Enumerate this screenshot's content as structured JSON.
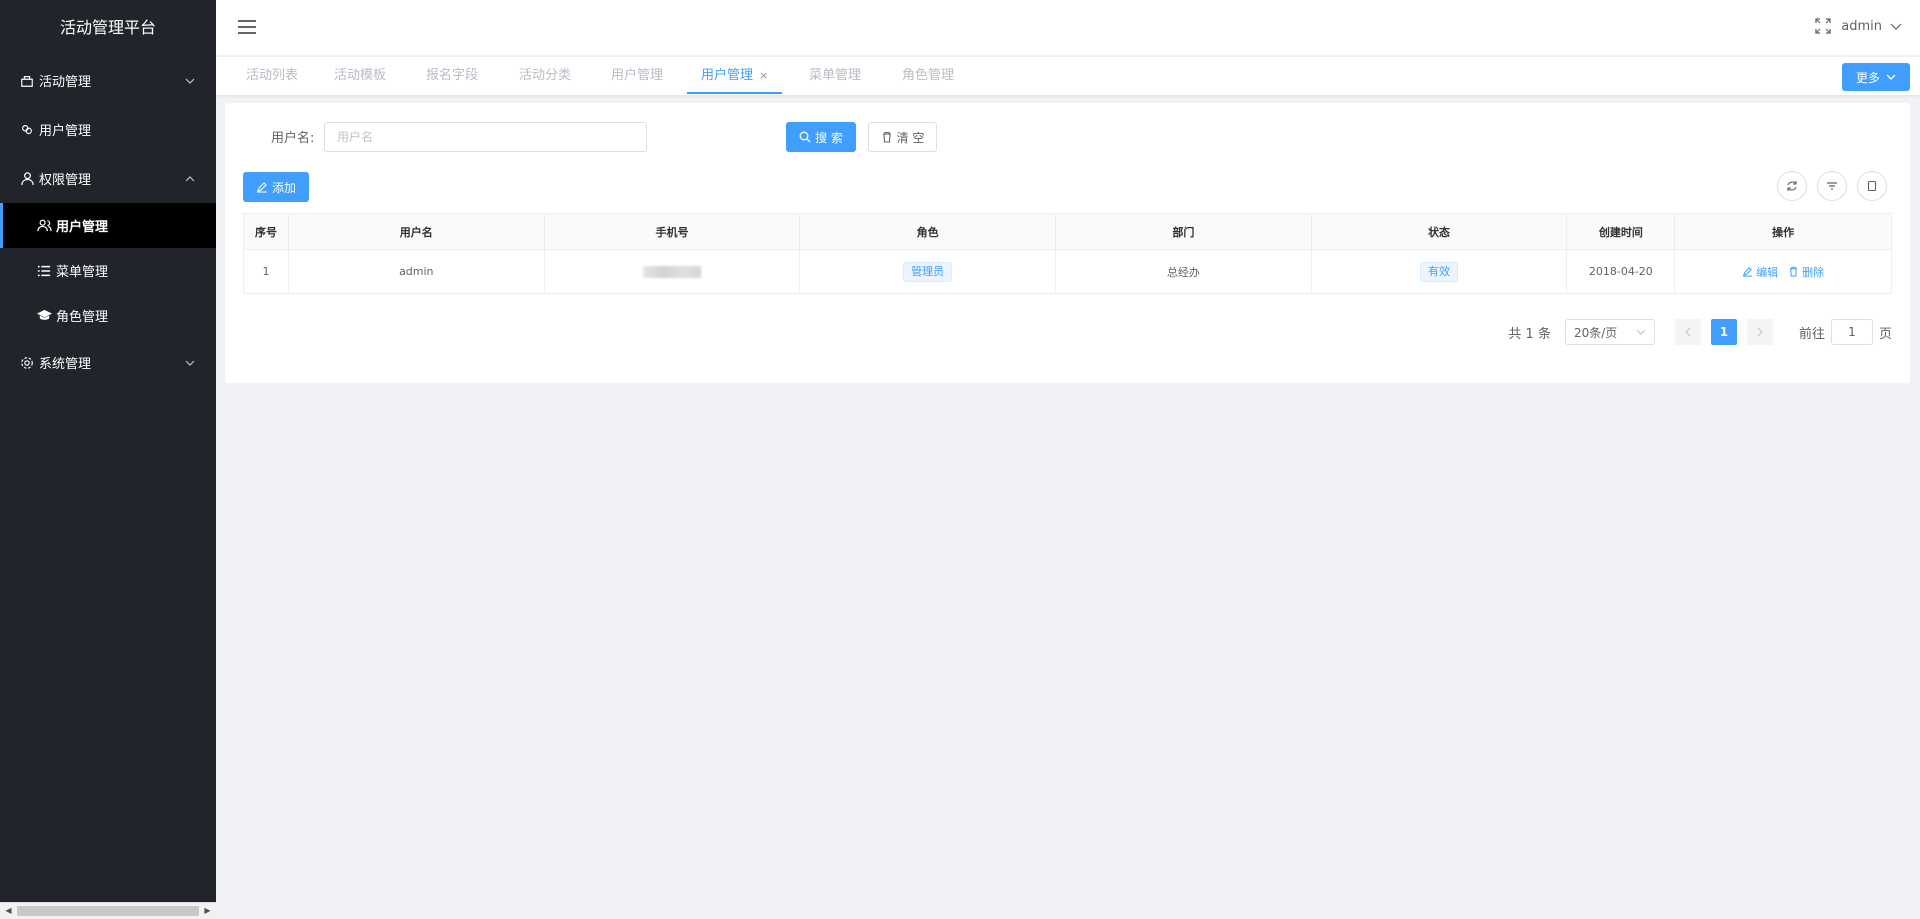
{
  "app": {
    "title": "活动管理平台"
  },
  "sidebar": {
    "menus": [
      {
        "label": "活动管理"
      },
      {
        "label": "用户管理"
      },
      {
        "label": "权限管理",
        "children": [
          {
            "label": "用户管理"
          },
          {
            "label": "菜单管理"
          },
          {
            "label": "角色管理"
          }
        ]
      },
      {
        "label": "系统管理"
      }
    ]
  },
  "header": {
    "user": "admin"
  },
  "tabs": {
    "items": [
      {
        "label": "活动列表"
      },
      {
        "label": "活动模板"
      },
      {
        "label": "报名字段"
      },
      {
        "label": "活动分类"
      },
      {
        "label": "用户管理"
      },
      {
        "label": "用户管理"
      },
      {
        "label": "菜单管理"
      },
      {
        "label": "角色管理"
      }
    ],
    "close_glyph": "×",
    "more_label": "更多"
  },
  "search": {
    "label": "用户名:",
    "placeholder": "用户名",
    "search_label": "搜 索",
    "clear_label": "清 空"
  },
  "toolbar": {
    "add_label": "添加"
  },
  "table": {
    "columns": [
      "序号",
      "用户名",
      "手机号",
      "角色",
      "部门",
      "状态",
      "创建时间",
      "操作"
    ],
    "rows": [
      {
        "index": "1",
        "username": "admin",
        "role": "管理员",
        "dept": "总经办",
        "status": "有效",
        "created": "2018-04-20",
        "edit": "编辑",
        "delete": "删除"
      }
    ]
  },
  "pagination": {
    "total": "共 1 条",
    "page_size": "20条/页",
    "current_page": "1",
    "goto_prefix": "前往",
    "goto_value": "1",
    "goto_suffix": "页"
  },
  "colors": {
    "primary": "#409eff",
    "sidebar_bg": "#22242c"
  }
}
